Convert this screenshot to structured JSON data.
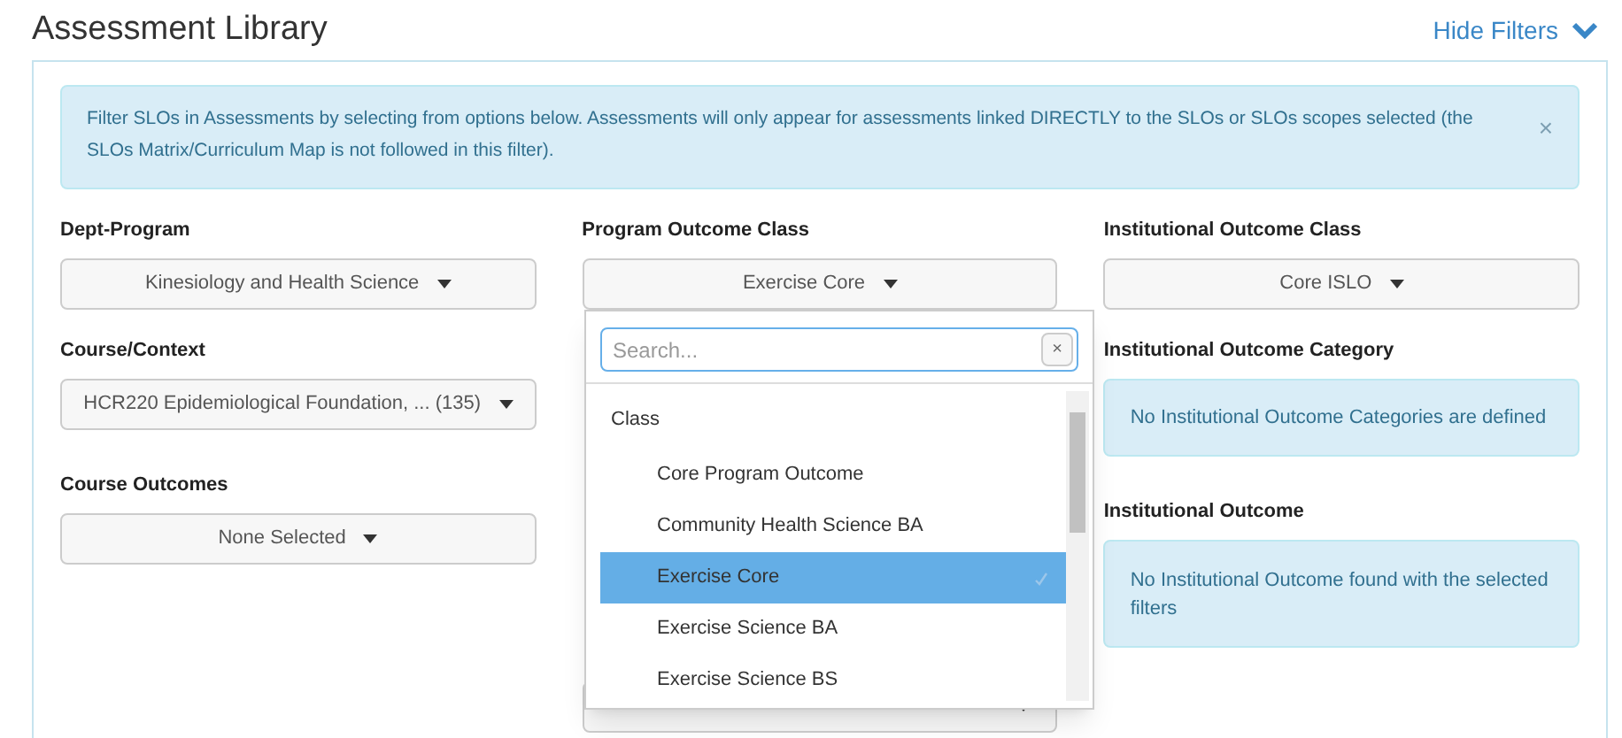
{
  "title": "Assessment Library",
  "hide_filters": {
    "label": "Hide Filters",
    "expanded": true
  },
  "alert": {
    "text": "Filter SLOs in Assessments by selecting from options below. Assessments will only appear for assessments linked DIRECTLY to the SLOs or SLOs scopes selected (the SLOs Matrix/Curriculum Map is not followed in this filter).",
    "close": "×"
  },
  "columns": [
    {
      "fields": [
        {
          "kind": "select",
          "label": "Dept-Program",
          "value": "Kinesiology and Health Science"
        },
        {
          "kind": "select",
          "label": "Course/Context",
          "value": "HCR220 Epidemiological Foundation, ... (135)"
        },
        {
          "kind": "select",
          "label": "Course Outcomes",
          "value": "None Selected"
        }
      ]
    },
    {
      "fields": [
        {
          "kind": "select",
          "label": "Program Outcome Class",
          "value": "Exercise Core"
        },
        {
          "kind": "select"
        }
      ]
    },
    {
      "fields": [
        {
          "kind": "select",
          "label": "Institutional Outcome Class",
          "value": "Core ISLO"
        },
        {
          "kind": "note",
          "label": "Institutional Outcome Category",
          "value": "No Institutional Outcome Categories are defined"
        },
        {
          "kind": "note",
          "label": "Institutional Outcome",
          "value": "No Institutional Outcome found with the selected filters"
        }
      ]
    }
  ],
  "dropdown": {
    "search_placeholder": "Search...",
    "clear": "×",
    "group": "Class",
    "options": [
      {
        "label": "Core Program Outcome",
        "selected": false
      },
      {
        "label": "Community Health Science BA",
        "selected": false
      },
      {
        "label": "Exercise Core",
        "selected": true
      },
      {
        "label": "Exercise Science BA",
        "selected": false
      },
      {
        "label": "Exercise Science BS",
        "selected": false
      }
    ]
  }
}
